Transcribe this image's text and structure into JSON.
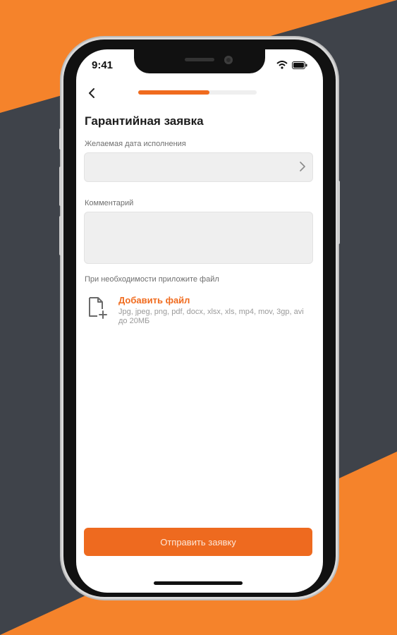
{
  "colors": {
    "accent": "#f06b1e",
    "background_orange": "#f5832b",
    "background_dark": "#3f434a"
  },
  "status_bar": {
    "time": "9:41",
    "icons": [
      "wifi-icon",
      "battery-icon"
    ]
  },
  "header": {
    "back_icon": "chevron-left-icon",
    "progress_fraction": 0.6
  },
  "form": {
    "title": "Гарантийная заявка",
    "date_label": "Желаемая дата исполнения",
    "date_value": "",
    "comment_label": "Комментарий",
    "comment_value": "",
    "attach_label": "При необходимости приложите файл",
    "add_file": "Добавить файл",
    "formats": "Jpg, jpeg, png, pdf, docx, xlsx, xls, mp4, mov, 3gp, avi до 20МБ"
  },
  "submit_label": "Отправить заявку"
}
